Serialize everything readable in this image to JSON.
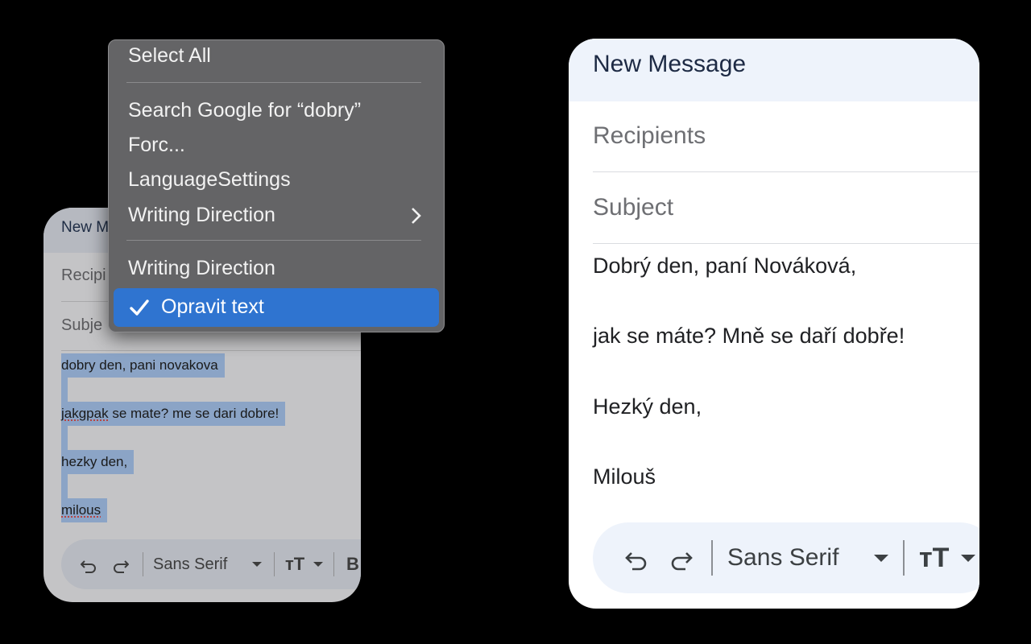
{
  "left_compose": {
    "title": "New M",
    "recipients_label": "Recipi",
    "subject_label": "Subje",
    "body_lines": [
      "dobry den, pani novakova",
      "jakgpak se mate? me se dari dobre!",
      "hezky den,",
      "milous"
    ],
    "misspelled": [
      "jakgpak",
      "milous"
    ],
    "toolbar": {
      "undo_icon": "undo-icon",
      "redo_icon": "redo-icon",
      "font_label": "Sans Serif",
      "size_icon": "text-size-icon",
      "bold_label": "B"
    }
  },
  "context_menu": {
    "items": [
      {
        "label": "Select All"
      },
      {
        "label": "Search Google for “dobry”"
      },
      {
        "label": "Forc..."
      },
      {
        "label": "LanguageSettings"
      },
      {
        "label": "Writing Direction",
        "submenu": true
      },
      {
        "label": "Writing Direction"
      },
      {
        "label": "Opravit text",
        "checked": true,
        "highlighted": true
      }
    ],
    "highlight_color": "#2f74d0"
  },
  "right_compose": {
    "title": "New Message",
    "recipients_placeholder": "Recipients",
    "subject_placeholder": "Subject",
    "body_lines": [
      "Dobrý den, paní Nováková,",
      "jak se máte? Mně se daří dobře!",
      "Hezký den,",
      "Milouš"
    ],
    "toolbar": {
      "undo_icon": "undo-icon",
      "redo_icon": "redo-icon",
      "font_label": "Sans Serif",
      "size_icon": "text-size-icon"
    }
  }
}
